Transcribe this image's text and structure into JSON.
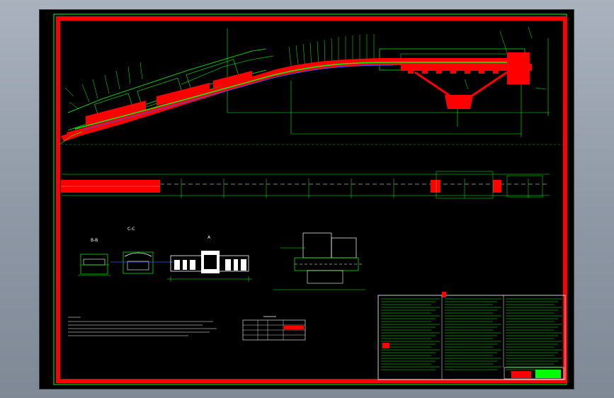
{
  "sheet": {
    "bg_color": "#000000",
    "border_color": "#ff0000",
    "line_color": "#00ff00",
    "accent_blue": "#3355ff"
  },
  "views": {
    "section_b_label": "B-B",
    "section_c_label": "C-C",
    "section_a_label": "A"
  }
}
